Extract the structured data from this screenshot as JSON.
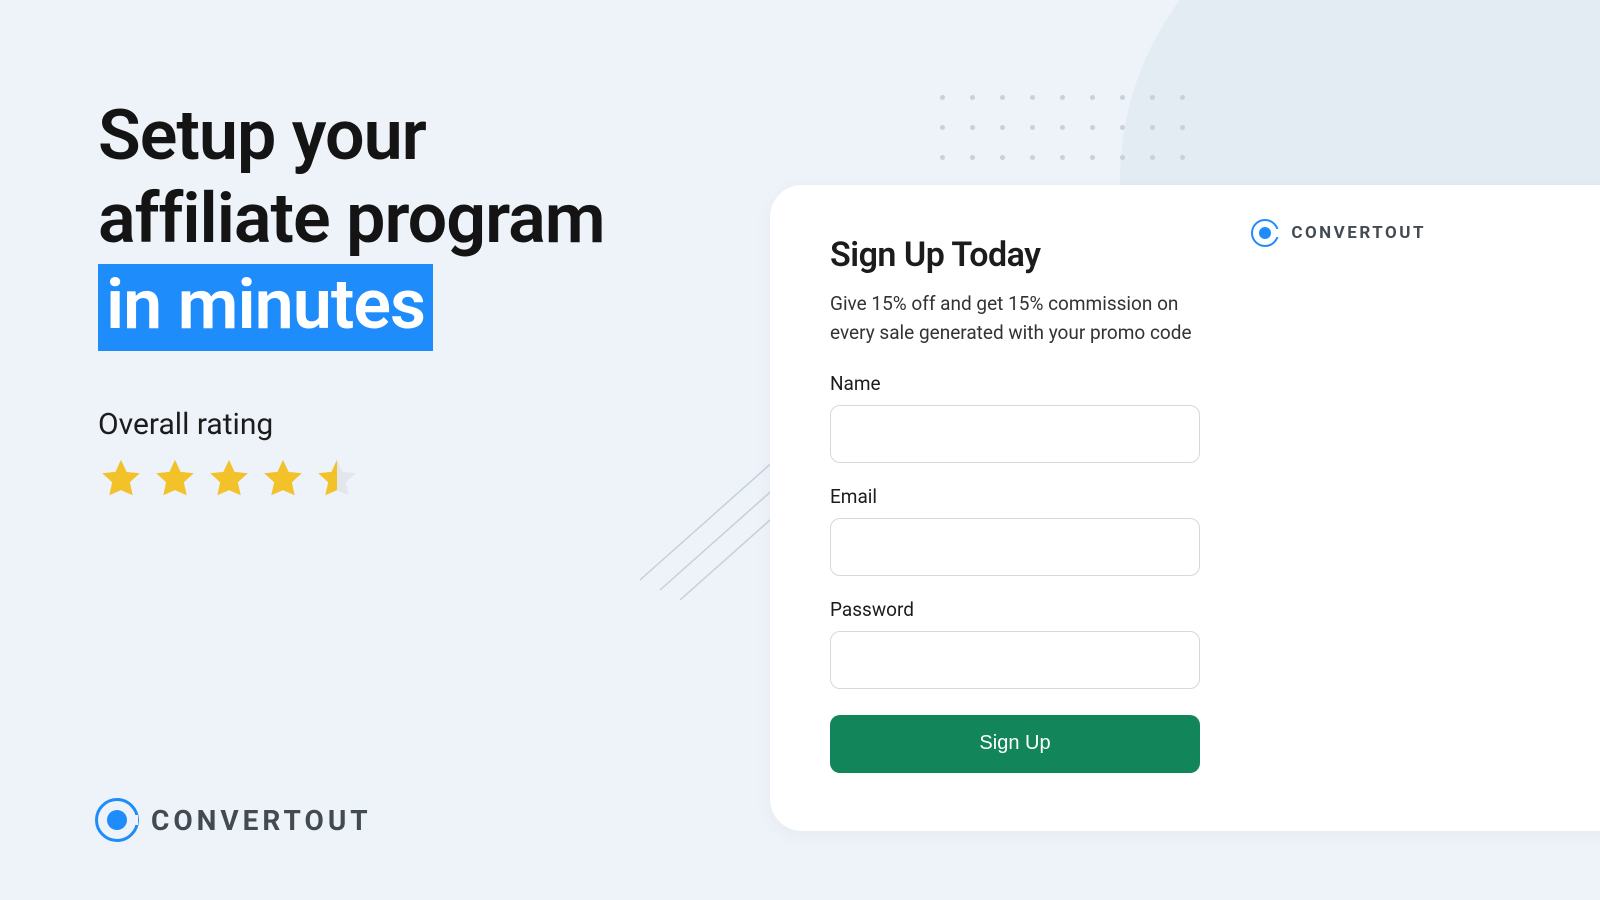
{
  "hero": {
    "headline_line1": "Setup your",
    "headline_line2": "affiliate program",
    "headline_highlight": "in minutes"
  },
  "rating": {
    "label": "Overall rating",
    "value": 4.5,
    "max": 5
  },
  "brand": {
    "name": "CONVERTOUT"
  },
  "card": {
    "title": "Sign Up Today",
    "subtitle": "Give 15% off and get 15% commission on every sale generated with your promo code",
    "fields": {
      "name": {
        "label": "Name",
        "value": ""
      },
      "email": {
        "label": "Email",
        "value": ""
      },
      "password": {
        "label": "Password",
        "value": ""
      }
    },
    "cta_label": "Sign Up"
  },
  "decor": {
    "dot_count": 27
  }
}
